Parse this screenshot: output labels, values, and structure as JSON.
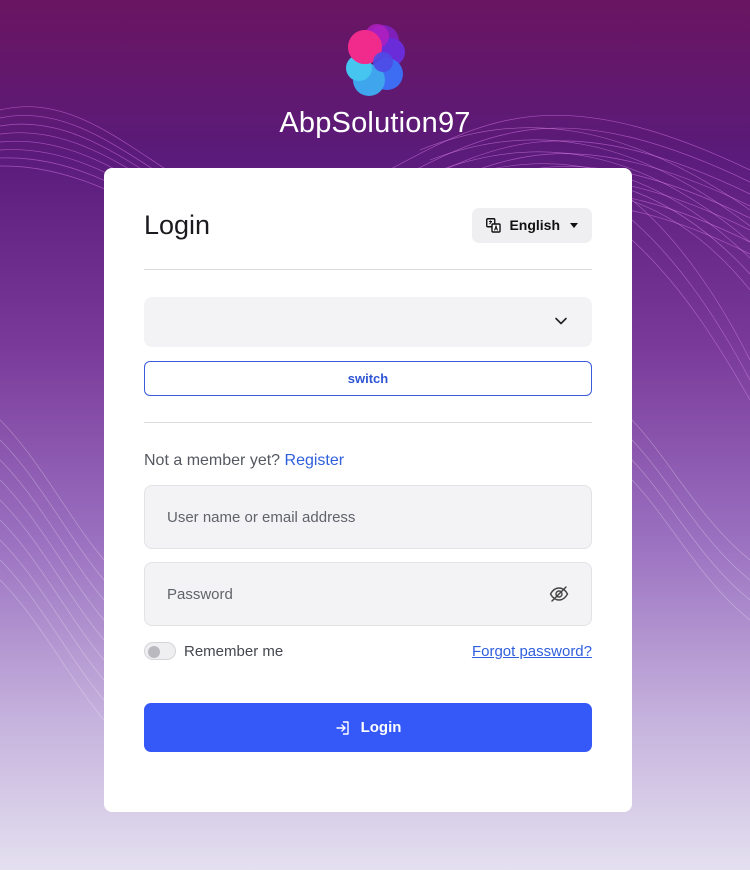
{
  "brand": {
    "app_name": "AbpSolution97",
    "logo_icon": "flower-logo-icon",
    "colors": {
      "pink": "#f02b8c",
      "purple": "#7d1fb8",
      "blue": "#3d6df2",
      "cyan": "#45c5f0"
    }
  },
  "card": {
    "title": "Login",
    "language": {
      "label": "English",
      "icon": "translate-icon"
    },
    "tenant_select": {
      "selected": "",
      "icon": "chevron-down-icon"
    },
    "switch_label": "switch",
    "register": {
      "prompt": "Not a member yet?",
      "link_label": "Register"
    },
    "username": {
      "placeholder": "User name or email address"
    },
    "password": {
      "placeholder": "Password",
      "icon": "eye-slash-icon"
    },
    "remember_me": {
      "label": "Remember me",
      "checked": false
    },
    "forgot_label": "Forgot password?",
    "login_button": {
      "label": "Login",
      "icon": "login-icon"
    }
  },
  "theme": {
    "accent": "#3558f8",
    "link": "#2f5fdc"
  }
}
